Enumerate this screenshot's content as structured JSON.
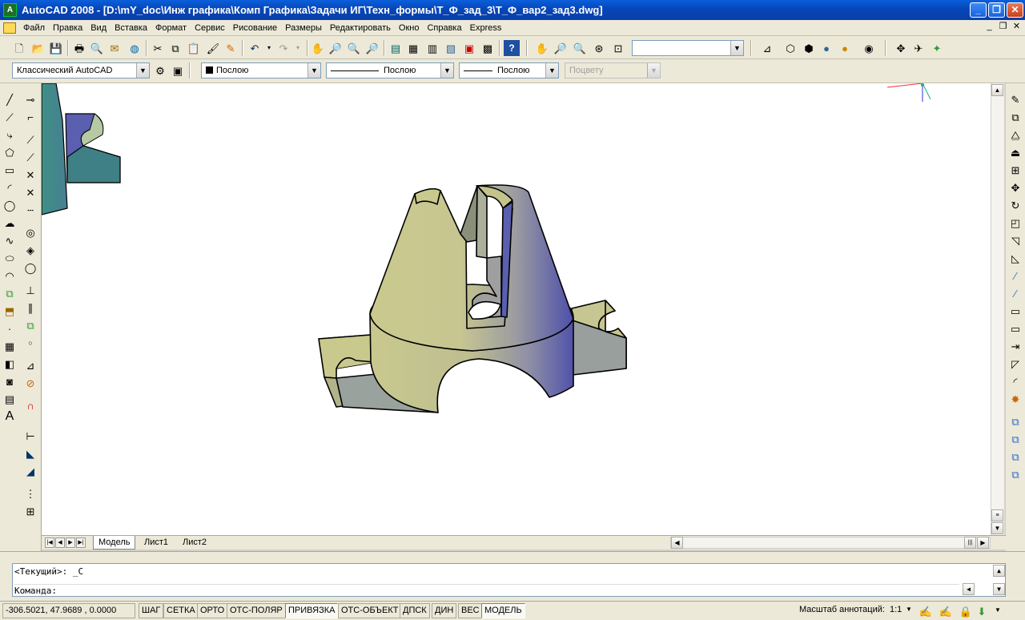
{
  "window": {
    "title": "AutoCAD 2008 - [D:\\mY_doc\\Инж графика\\Комп Графика\\Задачи ИГ\\Техн_формы\\Т_Ф_зад_3\\Т_Ф_вар2_зад3.dwg]",
    "app_icon": "A"
  },
  "window_buttons": {
    "minimize": "_",
    "restore": "❐",
    "close": "✕"
  },
  "menu": {
    "items": [
      "Файл",
      "Правка",
      "Вид",
      "Вставка",
      "Формат",
      "Сервис",
      "Рисование",
      "Размеры",
      "Редактировать",
      "Окно",
      "Справка",
      "Express"
    ],
    "mdi_minimize": "_",
    "mdi_restore": "❐",
    "mdi_close": "✕"
  },
  "toolbar2": {
    "workspace": "Классический AutoCAD",
    "color": "Послою",
    "linetype": "Послою",
    "lineweight": "Послою",
    "plotstyle": "Поцвету",
    "view_combo": ""
  },
  "tabs": {
    "model": "Модель",
    "layout1": "Лист1",
    "layout2": "Лист2"
  },
  "command": {
    "line1": "<Текущий>: _C",
    "line2": "Команда:"
  },
  "status": {
    "coords": "-306.5021, 47.9689 , 0.0000",
    "buttons": [
      "ШАГ",
      "СЕТКА",
      "ОРТО",
      "ОТС-ПОЛЯР",
      "ПРИВЯЗКА",
      "ОТС-ОБЪЕКТ",
      "ДПСК",
      "ДИН",
      "ВЕС",
      "МОДЕЛЬ"
    ],
    "annotation_label": "Масштаб аннотаций:",
    "annotation_scale": "1:1"
  },
  "colors": {
    "title_bar": "#0a4fc8",
    "model_khaki": "#c9c98e",
    "model_blue": "#5a5fb0",
    "model_gray": "#909a96"
  }
}
